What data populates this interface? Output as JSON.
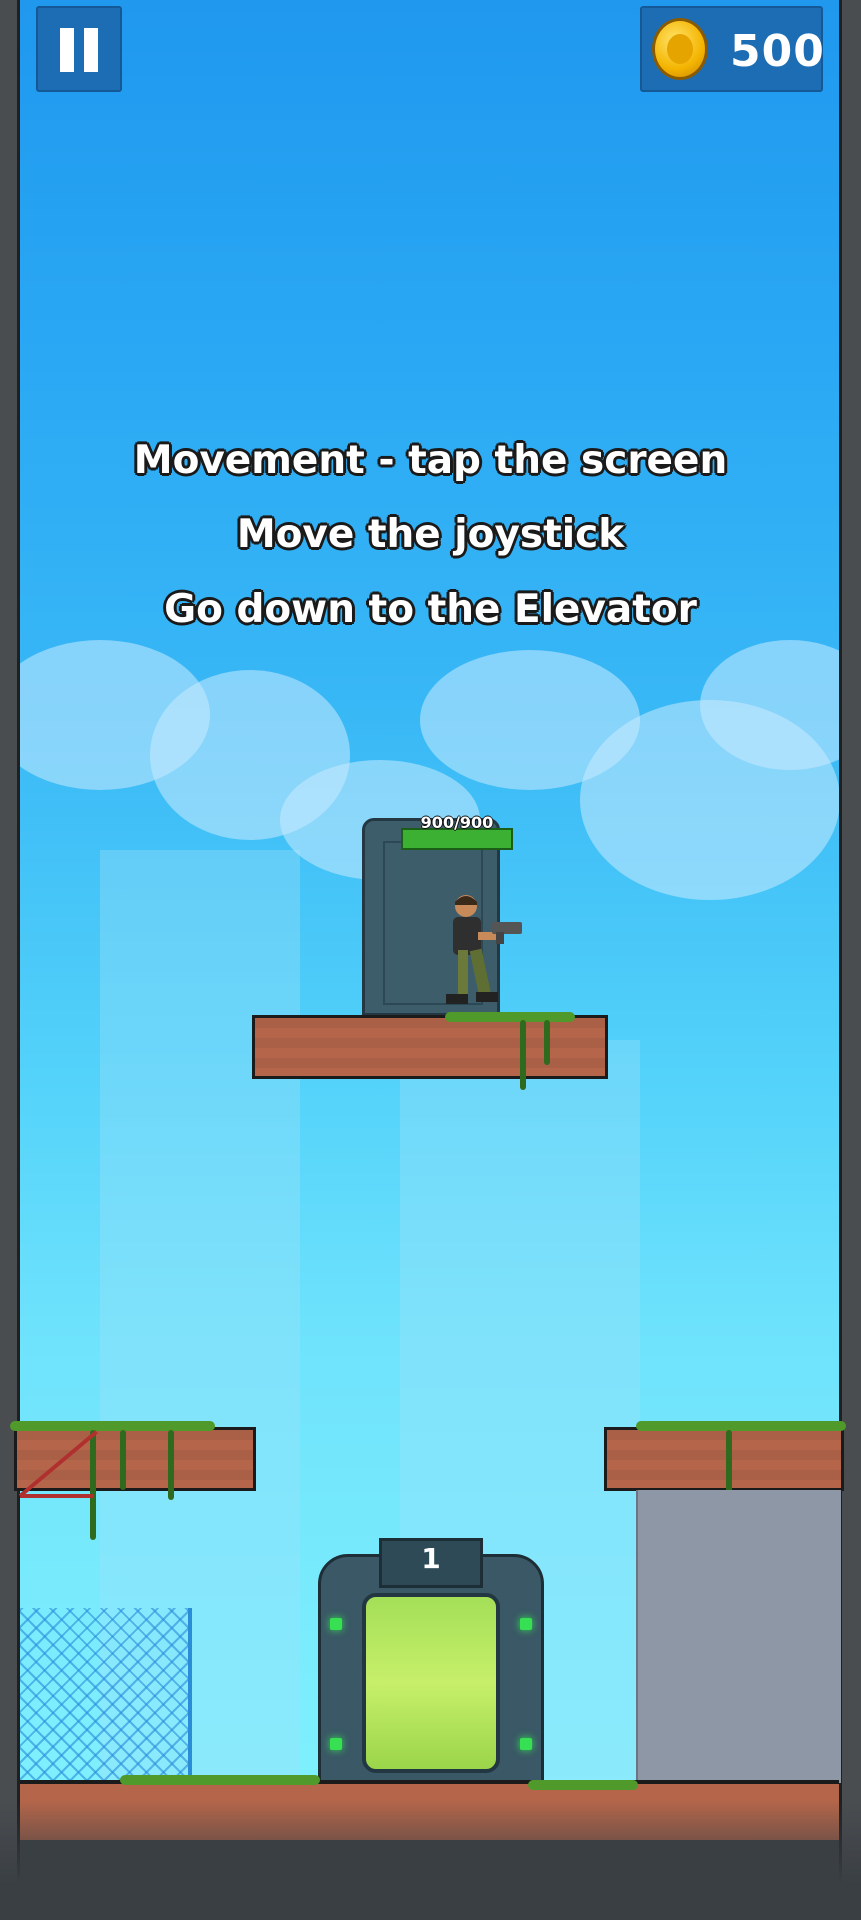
{
  "hud": {
    "pause_icon": "pause-icon",
    "coin_icon": "coin-icon",
    "coin_count": "500"
  },
  "instructions": {
    "line1": "Movement -  tap the screen",
    "line2": "Move the joystick",
    "line3": "Go down to the Elevator"
  },
  "player": {
    "health_text": "900/900",
    "health_fraction": 1.0
  },
  "elevator": {
    "number": "1"
  },
  "colors": {
    "sky_top": "#1f98ee",
    "sky_bottom": "#7ff0fd",
    "hud_panel": "#1c6db3",
    "brick": "#b5664a",
    "grass": "#4f9a2a",
    "health_bar": "#3bb032",
    "elevator_glass": "#c7ef6a"
  }
}
